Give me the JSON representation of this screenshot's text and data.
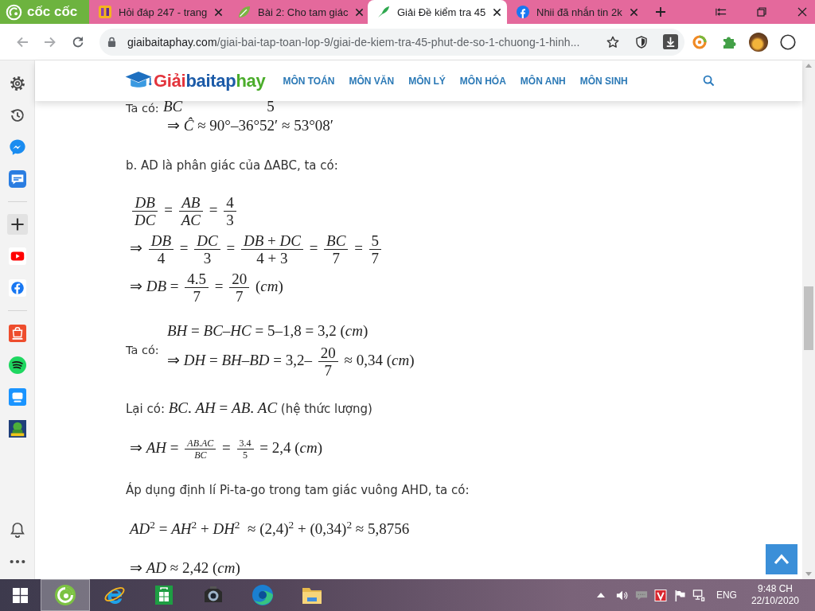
{
  "browser": {
    "brand": "cốc cốc",
    "tabs": [
      {
        "title": "Hỏi đáp 247 - trang",
        "selected": false
      },
      {
        "title": "Bài 2: Cho tam giác",
        "selected": false
      },
      {
        "title": "Giải Đề kiểm tra 45",
        "selected": true
      },
      {
        "title": "Nhii đã nhắn tin 2k",
        "selected": false
      }
    ],
    "address": {
      "host": "giaibaitaphay.com",
      "path": "/giai-bai-tap-toan-lop-9/giai-de-kiem-tra-45-phut-de-so-1-chuong-1-hinh..."
    }
  },
  "site_header": {
    "logo": [
      {
        "text": "Giải",
        "color": "#e3343c"
      },
      {
        "text": "baitap",
        "color": "#1c5ba8"
      },
      {
        "text": "hay",
        "color": "#4bad2b"
      }
    ],
    "nav": [
      "MÔN TOÁN",
      "MÔN VĂN",
      "MÔN LÝ",
      "MÔN HÓA",
      "MÔN ANH",
      "MÔN SINH"
    ]
  },
  "content": [
    {
      "kind": "labeled",
      "label": "Ta có:",
      "lines": [
        {
          "kind": "partial",
          "parts": [
            {
              "kind": "text",
              "text": "*BC*"
            },
            {
              "kind": "text",
              "text": "5"
            }
          ]
        },
        {
          "kind": "formula",
          "parts": [
            {
              "kind": "text",
              "text": "⇒ *Ĉ* ≈ 90°–36°52′ ≈ 53°08′"
            }
          ]
        }
      ]
    },
    {
      "kind": "paragraph",
      "parts": [
        {
          "kind": "text",
          "text": "b. AD là phân giác của ΔABC, ta có:"
        }
      ]
    },
    {
      "kind": "display",
      "lines": [
        {
          "kind": "formula",
          "parts": [
            {
              "kind": "frac",
              "num": "*DB*",
              "den": "*DC*"
            },
            {
              "kind": "text",
              "text": " = "
            },
            {
              "kind": "frac",
              "num": "*AB*",
              "den": "*AC*"
            },
            {
              "kind": "text",
              "text": " = "
            },
            {
              "kind": "frac",
              "num": "4",
              "den": "3"
            }
          ]
        },
        {
          "kind": "formula",
          "parts": [
            {
              "kind": "text",
              "text": "⇒ "
            },
            {
              "kind": "frac",
              "num": "*DB*",
              "den": "4"
            },
            {
              "kind": "text",
              "text": " = "
            },
            {
              "kind": "frac",
              "num": "*DC*",
              "den": "3"
            },
            {
              "kind": "text",
              "text": " = "
            },
            {
              "kind": "frac",
              "num": "*DB* + *DC*",
              "den": "4 + 3"
            },
            {
              "kind": "text",
              "text": " = "
            },
            {
              "kind": "frac",
              "num": "*BC*",
              "den": "7"
            },
            {
              "kind": "text",
              "text": " = "
            },
            {
              "kind": "frac",
              "num": "5",
              "den": "7"
            }
          ]
        },
        {
          "kind": "formula",
          "parts": [
            {
              "kind": "text",
              "text": "⇒ *DB* = "
            },
            {
              "kind": "frac",
              "num": "4.5",
              "den": "7"
            },
            {
              "kind": "text",
              "text": " = "
            },
            {
              "kind": "frac",
              "num": "20",
              "den": "7"
            },
            {
              "kind": "text",
              "text": " (*cm*)"
            }
          ]
        }
      ]
    },
    {
      "kind": "labeled",
      "label": "Ta có:",
      "lines": [
        {
          "kind": "formula",
          "parts": [
            {
              "kind": "text",
              "text": "*BH* = *BC*–*HC* = 5–1,8 = 3,2 (*cm*)"
            }
          ]
        },
        {
          "kind": "formula",
          "parts": [
            {
              "kind": "text",
              "text": "⇒ *DH* = *BH*–*BD* = 3,2– "
            },
            {
              "kind": "frac",
              "num": "20",
              "den": "7"
            },
            {
              "kind": "text",
              "text": " ≈ 0,34 (*cm*)"
            }
          ]
        }
      ]
    },
    {
      "kind": "paragraph",
      "parts": [
        {
          "kind": "text",
          "text": "Lại có: "
        },
        {
          "kind": "math",
          "text": "*BC*. *AH* = *AB*. *AC*"
        },
        {
          "kind": "text",
          "text": " (hệ thức lượng)"
        }
      ]
    },
    {
      "kind": "display",
      "lines": [
        {
          "kind": "formula",
          "parts": [
            {
              "kind": "text",
              "text": "⇒ *AH* = "
            },
            {
              "kind": "small-frac",
              "num": "*AB*.*AC*",
              "den": "*BC*"
            },
            {
              "kind": "text",
              "text": " = "
            },
            {
              "kind": "small-frac",
              "num": "3.4",
              "den": "5"
            },
            {
              "kind": "text",
              "text": " = 2,4 (*cm*)"
            }
          ]
        }
      ]
    },
    {
      "kind": "paragraph",
      "parts": [
        {
          "kind": "text",
          "text": "Áp dụng định lí Pi-ta-go trong tam giác vuông AHD, ta có:"
        }
      ]
    },
    {
      "kind": "display",
      "lines": [
        {
          "kind": "formula",
          "parts": [
            {
              "kind": "text",
              "text": "*AD*$^{2}$ = *AH*$^{2}$ + *DH*$^{2}$  ≈ (2,4)$^{2}$ + (0,34)$^{2}$ ≈ 5,8756"
            }
          ]
        }
      ]
    },
    {
      "kind": "display",
      "lines": [
        {
          "kind": "formula",
          "parts": [
            {
              "kind": "text",
              "text": "⇒ *AD* ≈ 2,42 (*cm*)"
            }
          ]
        }
      ]
    }
  ],
  "taskbar": {
    "apps": [
      {
        "kind": "coccoc",
        "selected": true
      },
      {
        "kind": "ie",
        "selected": false
      },
      {
        "kind": "store",
        "selected": false
      },
      {
        "kind": "camera",
        "selected": false
      },
      {
        "kind": "edge",
        "selected": false
      },
      {
        "kind": "explorer",
        "selected": false
      }
    ],
    "language": "ENG",
    "time": "9:48 CH",
    "date": "22/10/2020"
  }
}
